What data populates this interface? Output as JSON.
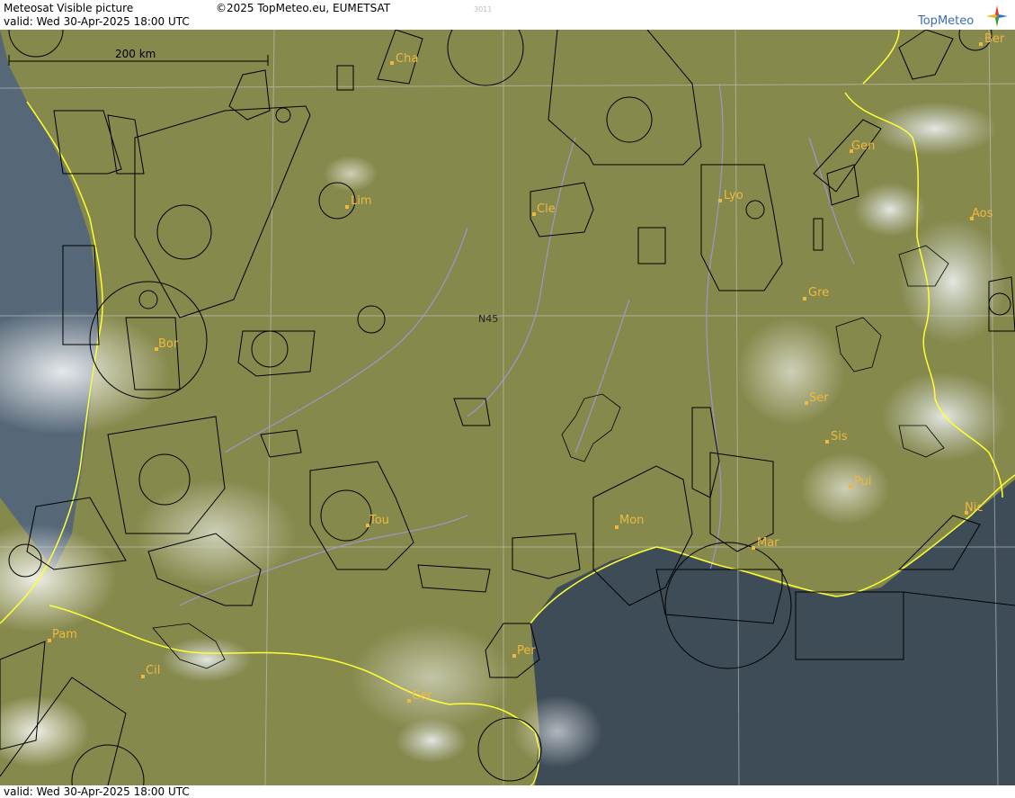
{
  "header": {
    "product": "Meteosat Visible picture",
    "copyright": "©2025 TopMeteo.eu, EUMETSAT",
    "code": "3011",
    "valid": "valid:  Wed  30-Apr-2025  18:00 UTC",
    "logo_text": "TopMeteo"
  },
  "footer": {
    "valid": "valid:  Wed  30-Apr-2025  18:00 UTC"
  },
  "map": {
    "scale_label": "200 km",
    "grid_label": "N45",
    "cities": [
      "Cha",
      "Lim",
      "Cle",
      "Lyo",
      "Gen",
      "Aos",
      "Gre",
      "Ber",
      "Bor",
      "Ser",
      "Sis",
      "Pui",
      "Tou",
      "Mon",
      "Mar",
      "Nic",
      "Pam",
      "Cil",
      "Per",
      "Cer"
    ],
    "colors": {
      "land": "#8d8a4e",
      "sea": "#3c4a56",
      "ocean": "#56677a",
      "border": "#ffff33",
      "river": "#9c9cec",
      "airspace": "#000000",
      "city": "#f0b840",
      "cloud": "#e8e4dc"
    }
  }
}
